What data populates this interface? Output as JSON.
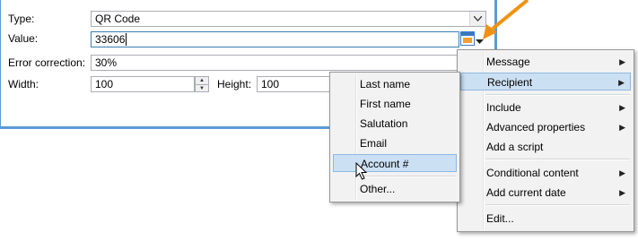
{
  "form": {
    "type_label": "Type:",
    "type_value": "QR Code",
    "value_label": "Value:",
    "value_value": "33606",
    "error_label": "Error correction:",
    "error_value": "30%",
    "width_label": "Width:",
    "width_value": "100",
    "height_label": "Height:",
    "height_value": "100"
  },
  "context_menu": {
    "items": [
      {
        "label": "Message"
      },
      {
        "label": "Recipient"
      },
      {
        "label": "Include"
      },
      {
        "label": "Advanced properties"
      },
      {
        "label": "Add a script"
      },
      {
        "label": "Conditional content"
      },
      {
        "label": "Add current date"
      },
      {
        "label": "Edit..."
      }
    ]
  },
  "recipient_submenu": {
    "items": [
      {
        "label": "Last name"
      },
      {
        "label": "First name"
      },
      {
        "label": "Salutation"
      },
      {
        "label": "Email"
      },
      {
        "label": "Account #"
      },
      {
        "label": "Other..."
      }
    ]
  },
  "colors": {
    "dialog_border": "#5b9bd5",
    "highlight": "#cce0f3",
    "callout_arrow": "#f29111",
    "icon_orange": "#f0a030",
    "icon_blue": "#3b78c3"
  }
}
